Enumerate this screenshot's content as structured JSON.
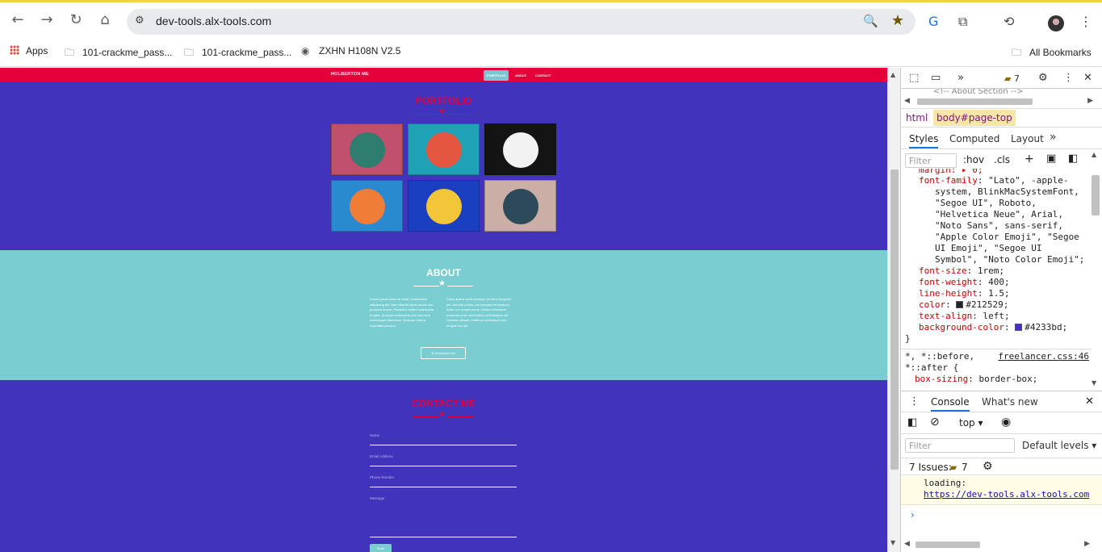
{
  "browser": {
    "url": "dev-tools.alx-tools.com",
    "bookmarks": [
      {
        "label": "Apps",
        "icon": "apps-grid-icon"
      },
      {
        "label": "101-crackme_pass...",
        "icon": "folder-icon"
      },
      {
        "label": "101-crackme_pass...",
        "icon": "folder-icon"
      },
      {
        "label": "ZXHN H108N V2.5",
        "icon": "globe-icon"
      }
    ],
    "all_bookmarks": "All Bookmarks"
  },
  "site": {
    "brand": "HOLBERTON ME",
    "nav": [
      "PORTFOLIO",
      "ABOUT",
      "CONTACT"
    ],
    "portfolio_title": "PORTFOLIO",
    "portfolio_items": [
      {
        "name": "cabin",
        "bg": "#c0506b",
        "circle": "#2e7d6e"
      },
      {
        "name": "cake",
        "bg": "#1fa1b6",
        "circle": "#e4563f"
      },
      {
        "name": "circus",
        "bg": "#141414",
        "circle": "#f2f2f2"
      },
      {
        "name": "game",
        "bg": "#2a8ad0",
        "circle": "#ef7c37"
      },
      {
        "name": "safe",
        "bg": "#1a3fc0",
        "circle": "#f3c63a"
      },
      {
        "name": "submarine",
        "bg": "#cbaea6",
        "circle": "#2c4a59"
      }
    ],
    "about_title": "ABOUT",
    "about_left": "Lorem ipsum dolor sit amet, consectetur adipiscing elit. Nam blandit turpis iaculis nisl pharetra auctor. Phasellus mattis malesuada feugiat. Quisque malesuada orci non risus scelerisque bibendum. Quisque viverra vulputate posuere.",
    "about_right": "Class aptent taciti sociosqu ad litora torquent per conubia nostra, per inceptos himenaeos. Nulla non ornare purus. Nullam bibendum nostimus urna, sed finibus velit tristique vel. Vivamus aliquet, mattis at scelerisque nec, feugiat non dui.",
    "download_label": "Download me!",
    "contact_title": "CONTACT ME",
    "fields": [
      "Name",
      "Email Address",
      "Phone Number",
      "Message"
    ],
    "send_label": "Send"
  },
  "devtools": {
    "issues_count": "7",
    "cut_text": "<!-- About Section -->",
    "crumbs": [
      "html",
      "body#page-top"
    ],
    "tabs": [
      "Styles",
      "Computed",
      "Layout"
    ],
    "filter_placeholder": "Filter",
    "hov": ":hov",
    "cls": ".cls",
    "css_top": "margin: ▸ 0;",
    "css": [
      {
        "prop": "font-family",
        "value": "\"Lato\", -apple-"
      },
      {
        "cont": "system, BlinkMacSystemFont,"
      },
      {
        "cont": "\"Segoe UI\", Roboto,"
      },
      {
        "cont": "\"Helvetica Neue\", Arial,"
      },
      {
        "cont": "\"Noto Sans\", sans-serif,"
      },
      {
        "cont": "\"Apple Color Emoji\", \"Segoe"
      },
      {
        "cont": "UI Emoji\", \"Segoe UI"
      },
      {
        "cont": "Symbol\", \"Noto Color Emoji\";"
      },
      {
        "prop": "font-size",
        "value": "1rem;"
      },
      {
        "prop": "font-weight",
        "value": "400;"
      },
      {
        "prop": "line-height",
        "value": "1.5;"
      },
      {
        "prop": "color",
        "value": "#212529;",
        "swatch": "#212529"
      },
      {
        "prop": "text-align",
        "value": "left;"
      },
      {
        "prop": "background-color",
        "value": "#4233bd;",
        "swatch": "#4233bd"
      }
    ],
    "close_brace": "}",
    "rule2_selector": "*, *::before,",
    "rule2_selector2": "*::after {",
    "rule2_link": "freelancer.css:46",
    "rule2_prop": "box-sizing",
    "rule2_value": "border-box;",
    "drawer_tabs": [
      "Console",
      "What's new"
    ],
    "context": "top",
    "console_filter": "Filter",
    "levels": "Default levels ▾",
    "issues_label": "7 Issues:",
    "log_prefix": "loading:",
    "log_url": "https://dev-tools.alx-tools.com"
  }
}
